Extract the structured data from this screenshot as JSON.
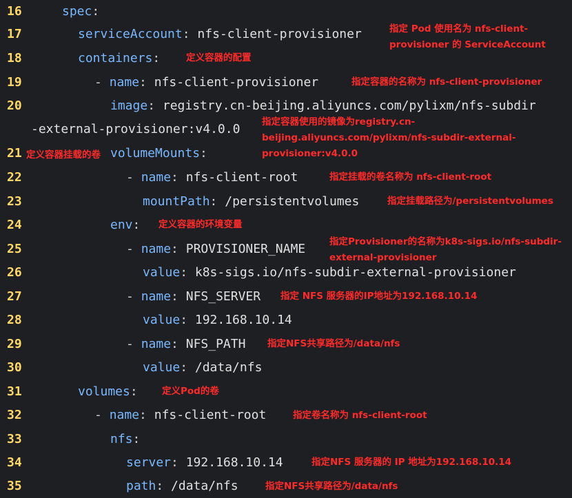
{
  "editor": {
    "lines": [
      {
        "n": "16",
        "dash": "",
        "key": "spec",
        "sep": ":",
        "val": ""
      },
      {
        "n": "17",
        "dash": "",
        "key": "serviceAccount",
        "sep": ": ",
        "val": "nfs-client-provisioner"
      },
      {
        "n": "18",
        "dash": "",
        "key": "containers",
        "sep": ":",
        "val": ""
      },
      {
        "n": "19",
        "dash": "- ",
        "key": "name",
        "sep": ": ",
        "val": "nfs-client-provisioner"
      },
      {
        "n": "20",
        "dash": "",
        "key": "image",
        "sep": ": ",
        "val": "registry.cn-beijing.aliyuncs.com/pylixm/nfs-subdir"
      },
      {
        "n": "",
        "dash": "",
        "key": "",
        "sep": "",
        "val": "-external-provisioner:v4.0.0"
      },
      {
        "n": "21",
        "dash": "",
        "key": "volumeMounts",
        "sep": ":",
        "val": ""
      },
      {
        "n": "22",
        "dash": "- ",
        "key": "name",
        "sep": ": ",
        "val": "nfs-client-root"
      },
      {
        "n": "23",
        "dash": "",
        "key": "mountPath",
        "sep": ": ",
        "val": "/persistentvolumes"
      },
      {
        "n": "24",
        "dash": "",
        "key": "env",
        "sep": ":",
        "val": ""
      },
      {
        "n": "25",
        "dash": "- ",
        "key": "name",
        "sep": ": ",
        "val": "PROVISIONER_NAME"
      },
      {
        "n": "26",
        "dash": "",
        "key": "value",
        "sep": ": ",
        "val": "k8s-sigs.io/nfs-subdir-external-provisioner"
      },
      {
        "n": "27",
        "dash": "- ",
        "key": "name",
        "sep": ": ",
        "val": "NFS_SERVER"
      },
      {
        "n": "28",
        "dash": "",
        "key": "value",
        "sep": ": ",
        "val": "192.168.10.14"
      },
      {
        "n": "29",
        "dash": "- ",
        "key": "name",
        "sep": ": ",
        "val": "NFS_PATH"
      },
      {
        "n": "30",
        "dash": "",
        "key": "value",
        "sep": ": ",
        "val": "/data/nfs"
      },
      {
        "n": "31",
        "dash": "",
        "key": "volumes",
        "sep": ":",
        "val": ""
      },
      {
        "n": "32",
        "dash": "- ",
        "key": "name",
        "sep": ": ",
        "val": "nfs-client-root"
      },
      {
        "n": "33",
        "dash": "",
        "key": "nfs",
        "sep": ":",
        "val": ""
      },
      {
        "n": "34",
        "dash": "",
        "key": "server",
        "sep": ": ",
        "val": "192.168.10.14"
      },
      {
        "n": "35",
        "dash": "",
        "key": "path",
        "sep": ": ",
        "val": "/data/nfs"
      }
    ]
  },
  "annotations": {
    "a17": "指定 Pod 使用名为 nfs-client-\nprovisioner 的 ServiceAccount",
    "a18": "定义容器的配置",
    "a19": "指定容器的名称为 nfs-client-provisioner",
    "a20": "指定容器使用的镜像为registry.cn-\nbeijing.aliyuncs.com/pylixm/nfs-subdir-external-\nprovisioner:v4.0.0",
    "a21": "定义容器挂载的卷",
    "a22": "指定挂载的卷名称为 nfs-client-root",
    "a23": "指定挂载路径为/persistentvolumes",
    "a24": "定义容器的环境变量",
    "a25": "指定Provisioner的名称为k8s-sigs.io/nfs-subdir-\nexternal-provisioner",
    "a27": "指定 NFS 服务器的IP地址为192.168.10.14",
    "a29": "指定NFS共享路径为/data/nfs",
    "a31": "定义Pod的卷",
    "a32": "指定卷名称为 nfs-client-root",
    "a34": "指定NFS 服务器的 IP 地址为192.168.10.14",
    "a35": "指定NFS共享路径为/data/nfs"
  }
}
